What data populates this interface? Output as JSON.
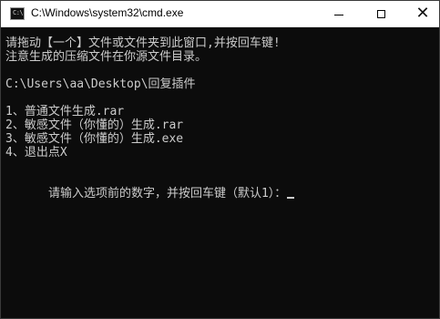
{
  "window": {
    "title": "C:\\Windows\\system32\\cmd.exe",
    "icon_text": "C:\\",
    "controls": {
      "minimize": "minimize",
      "maximize": "maximize",
      "close": "✕"
    }
  },
  "console": {
    "lines": [
      "请拖动【一个】文件或文件夹到此窗口,并按回车键!",
      "注意生成的压缩文件在你源文件目录。",
      "",
      "C:\\Users\\aa\\Desktop\\回复插件",
      "",
      "1、普通文件生成.rar",
      "2、敏感文件（你懂的）生成.rar",
      "3、敏感文件（你懂的）生成.exe",
      "4、退出点X",
      "",
      "请输入选项前的数字，并按回车键（默认1）："
    ]
  },
  "colors": {
    "console_bg": "#0c0c0c",
    "console_fg": "#cccccc",
    "titlebar_bg": "#ffffff"
  },
  "icons": {
    "app": "terminal-icon",
    "minimize": "minimize-icon",
    "maximize": "maximize-icon",
    "close": "close-icon"
  }
}
